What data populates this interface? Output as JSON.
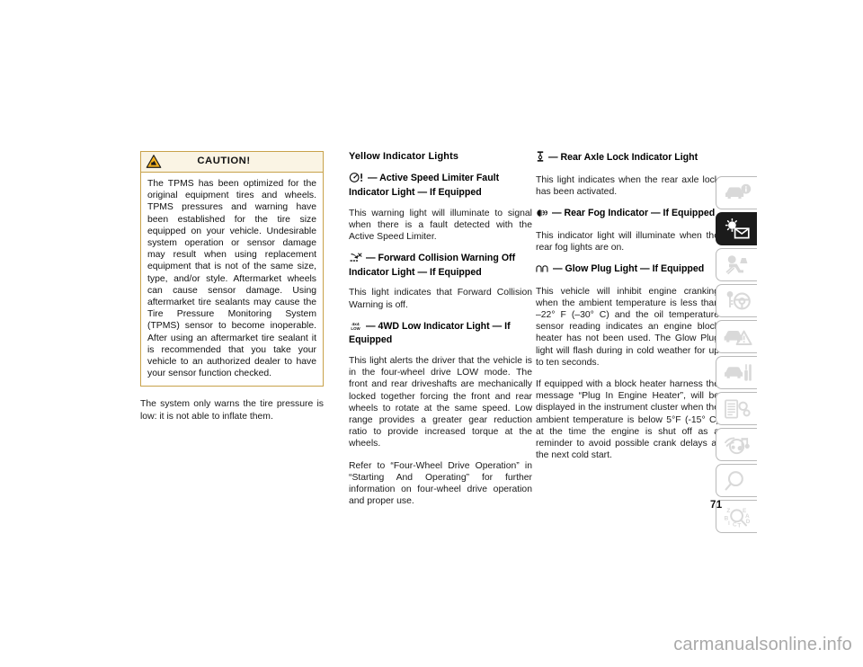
{
  "page": {
    "number": "71",
    "watermark": "carmanualsonline.info"
  },
  "left_column": {
    "caution": {
      "icon": "caution-triangle-icon",
      "title": "CAUTION!",
      "body": "The TPMS has been optimized for the original equipment tires and wheels. TPMS pressures and warning have been established for the tire size equipped on your vehicle. Undesirable system operation or sensor damage may result when using replacement equipment that is not of the same size, type, and/or style. Aftermarket wheels can cause sensor damage. Using aftermarket tire sealants may cause the Tire Pressure Monitoring System (TPMS) sensor to become inoperable. After using an aftermarket tire sealant it is recommended that you take your vehicle to an authorized dealer to have your sensor function checked."
    },
    "paragraph": "The system only warns the tire pressure is low: it is not able to inflate them."
  },
  "middle_column": {
    "section_title": "Yellow Indicator Lights",
    "entries": [
      {
        "icon": "speed-limiter-fault-icon",
        "heading": "— Active Speed Limiter Fault Indicator Light — If Equipped",
        "body": "This warning light will illuminate to signal when there is a fault detected with the Active Speed Limiter."
      },
      {
        "icon": "forward-collision-warning-off-icon",
        "heading": "— Forward Collision Warning Off Indicator Light — If Equipped",
        "body": "This light indicates that Forward Collision Warning is off."
      },
      {
        "icon": "4wd-low-icon",
        "heading": "— 4WD Low Indicator Light — If Equipped",
        "body": "This light alerts the driver that the vehicle is in the four-wheel drive LOW mode. The front and rear driveshafts are mechanically locked together forcing the front and rear wheels to rotate at the same speed. Low range provides a greater gear reduction ratio to provide increased torque at the wheels.",
        "body2": "Refer to “Four-Wheel Drive Operation” in “Starting And Operating” for further information on four-wheel drive operation and proper use."
      }
    ]
  },
  "right_column": {
    "entries": [
      {
        "icon": "rear-axle-lock-icon",
        "heading": "— Rear Axle Lock Indicator Light",
        "body": "This light indicates when the rear axle lock has been activated."
      },
      {
        "icon": "rear-fog-icon",
        "heading": "— Rear Fog Indicator — If Equipped",
        "body": "This indicator light will illuminate when the rear fog lights are on."
      },
      {
        "icon": "glow-plug-icon",
        "heading": "— Glow Plug Light — If Equipped",
        "body": "This vehicle will inhibit engine cranking when the ambient temperature is less than –22° F (–30° C) and the oil temperature sensor reading indicates an engine block heater has not been used. The Glow Plug light will flash during in cold weather for up to ten seconds.",
        "body2": "If equipped with a block heater harness the message “Plug In Engine Heater”, will be displayed in the instrument cluster when the ambient temperature is below 5°F (-15° C) at the time the engine is shut off as a reminder to avoid possible crank delays at the next cold start."
      }
    ]
  },
  "tab_strip": {
    "tabs": [
      {
        "name": "car-info-tab",
        "icon": "car-info-icon",
        "active": false
      },
      {
        "name": "warning-lights-messages-tab",
        "icon": "bulb-envelope-icon",
        "active": true
      },
      {
        "name": "occupant-safety-tab",
        "icon": "seatbelt-airbag-icon",
        "active": false
      },
      {
        "name": "starting-operating-tab",
        "icon": "steering-wheel-key-icon",
        "active": false
      },
      {
        "name": "emergency-tab",
        "icon": "car-warning-triangle-icon",
        "active": false
      },
      {
        "name": "servicing-maintenance-tab",
        "icon": "car-wrench-icon",
        "active": false
      },
      {
        "name": "technical-specifications-tab",
        "icon": "document-gear-icon",
        "active": false
      },
      {
        "name": "multimedia-tab",
        "icon": "radio-music-icon",
        "active": false
      },
      {
        "name": "index-search-tab",
        "icon": "magnifier-icon",
        "active": false
      },
      {
        "name": "alphabetical-index-tab",
        "icon": "abc-magnifier-icon",
        "active": false
      }
    ]
  },
  "colors": {
    "caution_border": "#c8a24a",
    "caution_header_bg": "#faf4e4",
    "tab_active_bg": "#1b1b1b",
    "tab_border": "#b9b9b9",
    "watermark": "#a9a9a9"
  }
}
